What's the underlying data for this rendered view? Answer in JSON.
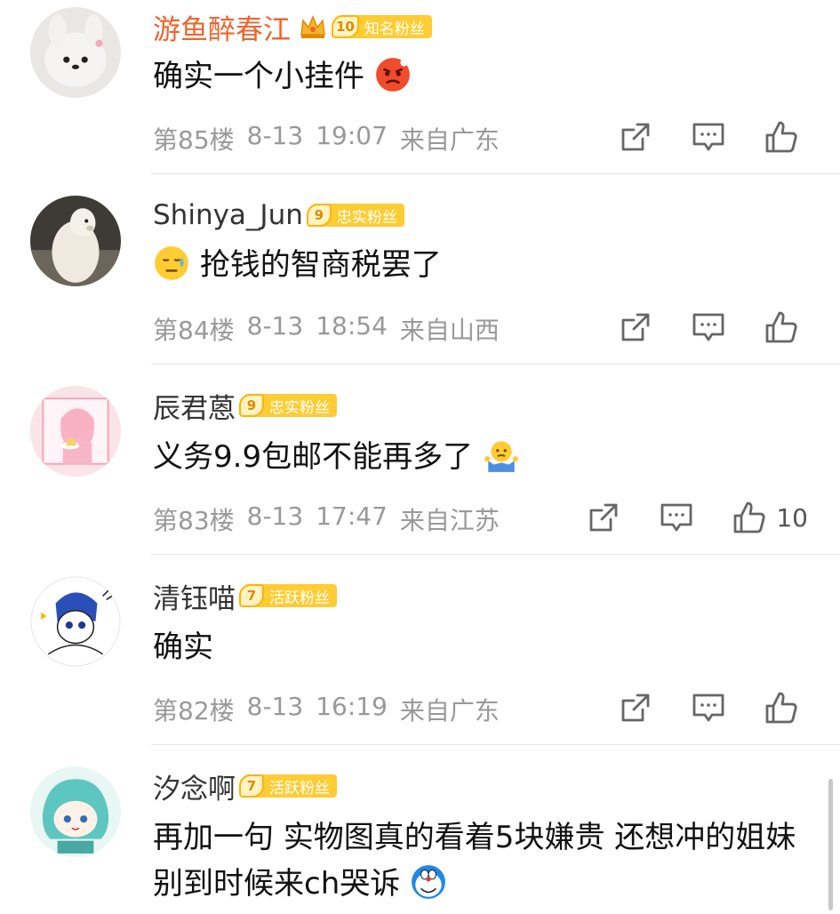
{
  "comments": [
    {
      "username": "游鱼醉春江",
      "username_color": "#f0632b",
      "has_crown": true,
      "badge_level": "10",
      "badge_text": "知名粉丝",
      "text": "确实一个小挂件",
      "emoji": "angry-face",
      "floor": "第85楼",
      "date": "8-13",
      "time": "19:07",
      "location": "来自广东",
      "likes": ""
    },
    {
      "username": "Shinya_Jun",
      "username_color": "#333333",
      "has_crown": false,
      "badge_level": "9",
      "badge_text": "忠实粉丝",
      "text": "抢钱的智商税罢了",
      "emoji": "sweat-face",
      "floor": "第84楼",
      "date": "8-13",
      "time": "18:54",
      "location": "来自山西",
      "likes": ""
    },
    {
      "username": "辰君蒽",
      "username_color": "#333333",
      "has_crown": false,
      "badge_level": "9",
      "badge_text": "忠实粉丝",
      "text": "义务9.9包邮不能再多了",
      "emoji": "shrug",
      "floor": "第83楼",
      "date": "8-13",
      "time": "17:47",
      "location": "来自江苏",
      "likes": "10"
    },
    {
      "username": "清钰喵",
      "username_color": "#333333",
      "has_crown": false,
      "badge_level": "7",
      "badge_text": "活跃粉丝",
      "text": "确实",
      "emoji": "",
      "floor": "第82楼",
      "date": "8-13",
      "time": "16:19",
      "location": "来自广东",
      "likes": ""
    },
    {
      "username": "汐念啊",
      "username_color": "#333333",
      "has_crown": false,
      "badge_level": "7",
      "badge_text": "活跃粉丝",
      "text": "再加一句 实物图真的看着5块嫌贵 还想冲的姐妹别到时候来ch哭诉",
      "emoji": "doraemon",
      "floor": "",
      "date": "",
      "time": "",
      "location": "",
      "likes": ""
    }
  ],
  "icons": {
    "share": "share-icon",
    "comment": "comment-icon",
    "like": "like-icon"
  }
}
